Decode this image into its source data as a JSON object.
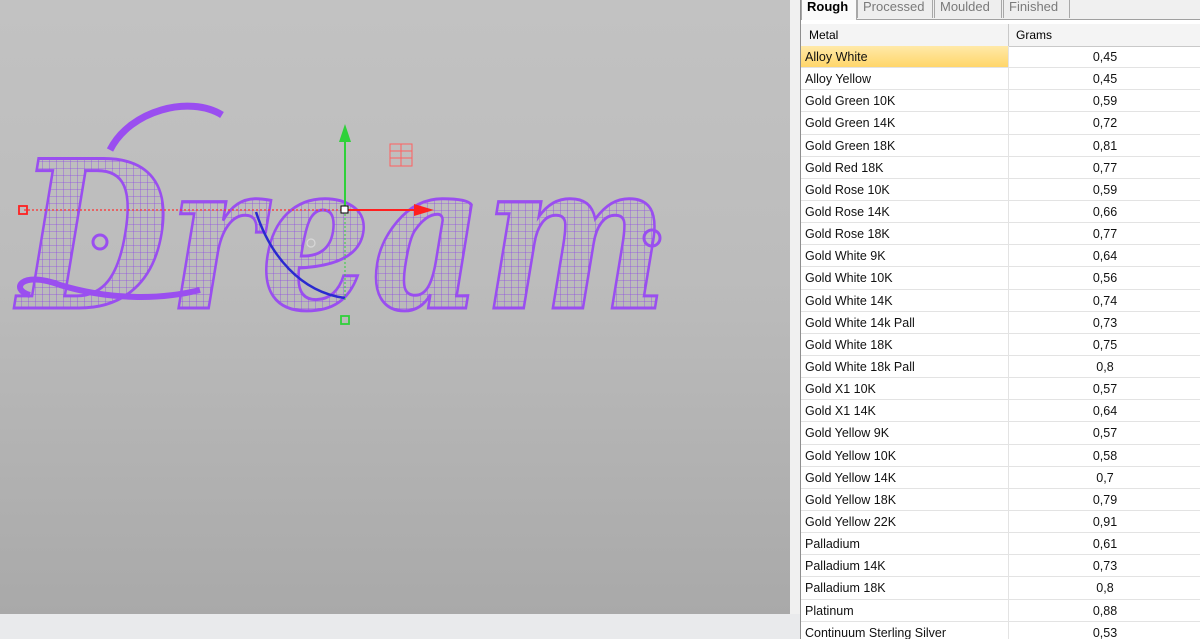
{
  "viewport": {
    "model_text": "Dream",
    "colors": {
      "wire": "#9a4ef0",
      "axis_x": "#ff2020",
      "axis_y": "#2fd13a",
      "curve": "#2a2ad0"
    }
  },
  "panel": {
    "tabs": [
      {
        "label": "Rough",
        "active": true
      },
      {
        "label": "Processed",
        "active": false
      },
      {
        "label": "Moulded",
        "active": false
      },
      {
        "label": "Finished",
        "active": false
      }
    ],
    "columns": {
      "metal": "Metal",
      "grams": "Grams"
    },
    "rows": [
      {
        "metal": "Alloy White",
        "grams": "0,45",
        "selected": true
      },
      {
        "metal": "Alloy Yellow",
        "grams": "0,45"
      },
      {
        "metal": "Gold Green 10K",
        "grams": "0,59"
      },
      {
        "metal": "Gold Green 14K",
        "grams": "0,72"
      },
      {
        "metal": "Gold Green 18K",
        "grams": "0,81"
      },
      {
        "metal": "Gold Red 18K",
        "grams": "0,77"
      },
      {
        "metal": "Gold Rose 10K",
        "grams": "0,59"
      },
      {
        "metal": "Gold Rose 14K",
        "grams": "0,66"
      },
      {
        "metal": "Gold Rose 18K",
        "grams": "0,77"
      },
      {
        "metal": "Gold White 9K",
        "grams": "0,64"
      },
      {
        "metal": "Gold White 10K",
        "grams": "0,56"
      },
      {
        "metal": "Gold White 14K",
        "grams": "0,74"
      },
      {
        "metal": "Gold White 14k Pall",
        "grams": "0,73"
      },
      {
        "metal": "Gold White 18K",
        "grams": "0,75"
      },
      {
        "metal": "Gold White 18k Pall",
        "grams": "0,8"
      },
      {
        "metal": "Gold X1 10K",
        "grams": "0,57"
      },
      {
        "metal": "Gold X1 14K",
        "grams": "0,64"
      },
      {
        "metal": "Gold Yellow 9K",
        "grams": "0,57"
      },
      {
        "metal": "Gold Yellow 10K",
        "grams": "0,58"
      },
      {
        "metal": "Gold Yellow 14K",
        "grams": "0,7"
      },
      {
        "metal": "Gold Yellow 18K",
        "grams": "0,79"
      },
      {
        "metal": "Gold Yellow 22K",
        "grams": "0,91"
      },
      {
        "metal": "Palladium",
        "grams": "0,61"
      },
      {
        "metal": "Palladium 14K",
        "grams": "0,73"
      },
      {
        "metal": "Palladium 18K",
        "grams": "0,8"
      },
      {
        "metal": "Platinum",
        "grams": "0,88"
      },
      {
        "metal": "Continuum Sterling Silver",
        "grams": "0,53"
      }
    ]
  }
}
